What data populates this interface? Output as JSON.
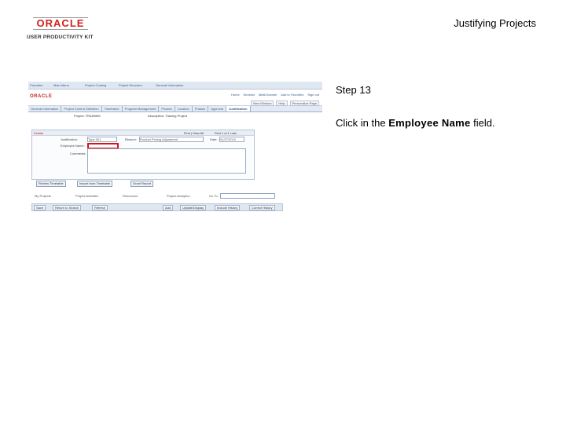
{
  "header": {
    "logo_top": "ORACLE",
    "logo_sub": "USER PRODUCTIVITY KIT",
    "doc_title": "Justifying Projects"
  },
  "step": {
    "label": "Step 13",
    "instruction_prefix": "Click in the ",
    "instruction_bold": "Employee Name",
    "instruction_suffix": " field."
  },
  "screenshot": {
    "brand": "ORACLE",
    "nav_items": [
      "Favorites",
      "Main Menu",
      "Project Costing",
      "Project Structure",
      "General Information"
    ],
    "top_links": [
      "Home",
      "Worklist",
      "MultiChannel",
      "Add to Favorites",
      "Sign out"
    ],
    "subbar": [
      "New Window",
      "Help",
      "Personalize Page"
    ],
    "tabs": [
      "General Information",
      "Project Control Definition",
      "Timeframe",
      "Program Management",
      "Phases",
      "Location",
      "Phases",
      "Approval",
      "Justification"
    ],
    "project_label": "Project: TRAINING",
    "project_desc": "Description: Training Project",
    "panel_title": "Details",
    "panel_find": "Find | View All",
    "panel_pager": "First 1 of 1 Last",
    "justification_label": "Justification:",
    "justification_value": "Type 001",
    "reason_label": "Reason:",
    "reason_value": "Product Pricing Adjustment",
    "date_label": "Date:",
    "date_value": "01/27/2012",
    "employee_label": "Employee Name:",
    "comments_label": "Comments:",
    "buttons": [
      "Review Timetable",
      "Import from Timetable",
      "Grant Report"
    ],
    "footer_labels": [
      "My Projects",
      "Project Activities",
      "Resources",
      "Project Analytics"
    ],
    "goto_label": "Go To:",
    "bottom_buttons": [
      "Save",
      "Return to Search",
      "Refresh",
      "Add",
      "Update/Display",
      "Include History",
      "Correct History"
    ]
  }
}
